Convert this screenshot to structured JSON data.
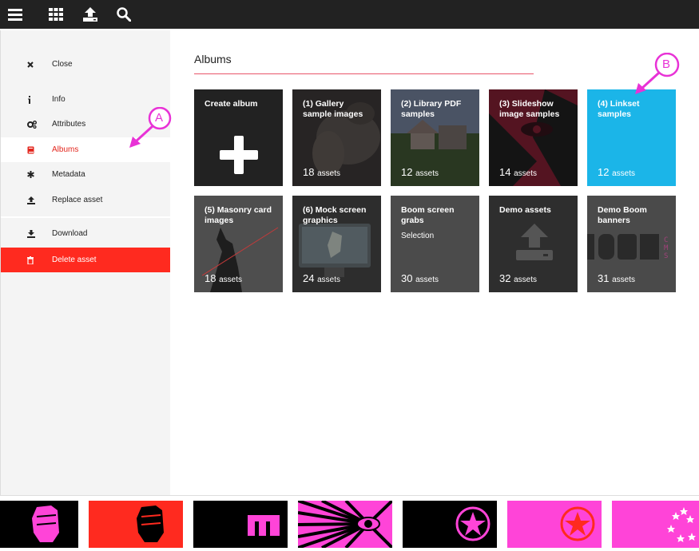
{
  "toolbar": {
    "menu_icon": "hamburger-menu-icon",
    "apps_icon": "grid-icon",
    "upload_icon": "upload-icon",
    "search_icon": "search-icon"
  },
  "sidebar": {
    "items": [
      {
        "label": "Close",
        "icon": "close-icon"
      },
      {
        "label": "Info",
        "icon": "info-icon"
      },
      {
        "label": "Attributes",
        "icon": "cogs-icon"
      },
      {
        "label": "Albums",
        "icon": "book-icon"
      },
      {
        "label": "Metadata",
        "icon": "asterisk-icon"
      },
      {
        "label": "Replace asset",
        "icon": "upload-icon"
      },
      {
        "label": "Download",
        "icon": "download-icon"
      },
      {
        "label": "Delete asset",
        "icon": "trash-icon"
      }
    ],
    "active_color": "#e3271e",
    "danger_color": "#ff2a1f"
  },
  "main": {
    "title": "Albums",
    "tiles": [
      {
        "title": "Create album",
        "count": "",
        "unit": "",
        "subtitle": "",
        "bg": "#222222"
      },
      {
        "title": "(1) Gallery sample images",
        "count": "18",
        "unit": "assets",
        "subtitle": "",
        "bg": "#3c3c3c"
      },
      {
        "title": "(2) Library PDF samples",
        "count": "12",
        "unit": "assets",
        "subtitle": "",
        "bg": "#3e4a44"
      },
      {
        "title": "(3) Slideshow image samples",
        "count": "14",
        "unit": "assets",
        "subtitle": "",
        "bg": "#5a1e2a"
      },
      {
        "title": "(4) Linkset samples",
        "count": "12",
        "unit": "assets",
        "subtitle": "",
        "bg": "#1bb5e8"
      },
      {
        "title": "(5) Masonry card images",
        "count": "18",
        "unit": "assets",
        "subtitle": "",
        "bg": "#4e4e4e"
      },
      {
        "title": "(6) Mock screen graphics",
        "count": "24",
        "unit": "assets",
        "subtitle": "",
        "bg": "#3a3a3a"
      },
      {
        "title": "Boom screen grabs",
        "count": "30",
        "unit": "assets",
        "subtitle": "Selection",
        "bg": "#4b4b4b"
      },
      {
        "title": "Demo assets",
        "count": "32",
        "unit": "assets",
        "subtitle": "",
        "bg": "#2e2e2e"
      },
      {
        "title": "Demo Boom banners",
        "count": "31",
        "unit": "assets",
        "subtitle": "",
        "bg": "#4a4a4a"
      }
    ]
  },
  "annotations": {
    "a_label": "A",
    "b_label": "B",
    "color": "#e832d6"
  },
  "strip": {
    "thumbs": [
      {
        "icon": "fist-icon",
        "bg": "#000000",
        "fg": "#ff44d8"
      },
      {
        "icon": "fist-icon",
        "bg": "#ff2a1f",
        "fg": "#000000"
      },
      {
        "icon": "m-logo-icon",
        "bg": "#000000",
        "fg": "#ff44d8"
      },
      {
        "icon": "eye-sunburst-icon",
        "bg": "#ff44d8",
        "fg": "#000000"
      },
      {
        "icon": "star-circle-icon",
        "bg": "#000000",
        "fg": "#ff44d8"
      },
      {
        "icon": "star-circle-icon",
        "bg": "#ff44d8",
        "fg": "#ff2a1f"
      },
      {
        "icon": "stars-icon",
        "bg": "#ff44d8",
        "fg": "#ffffff"
      }
    ]
  }
}
